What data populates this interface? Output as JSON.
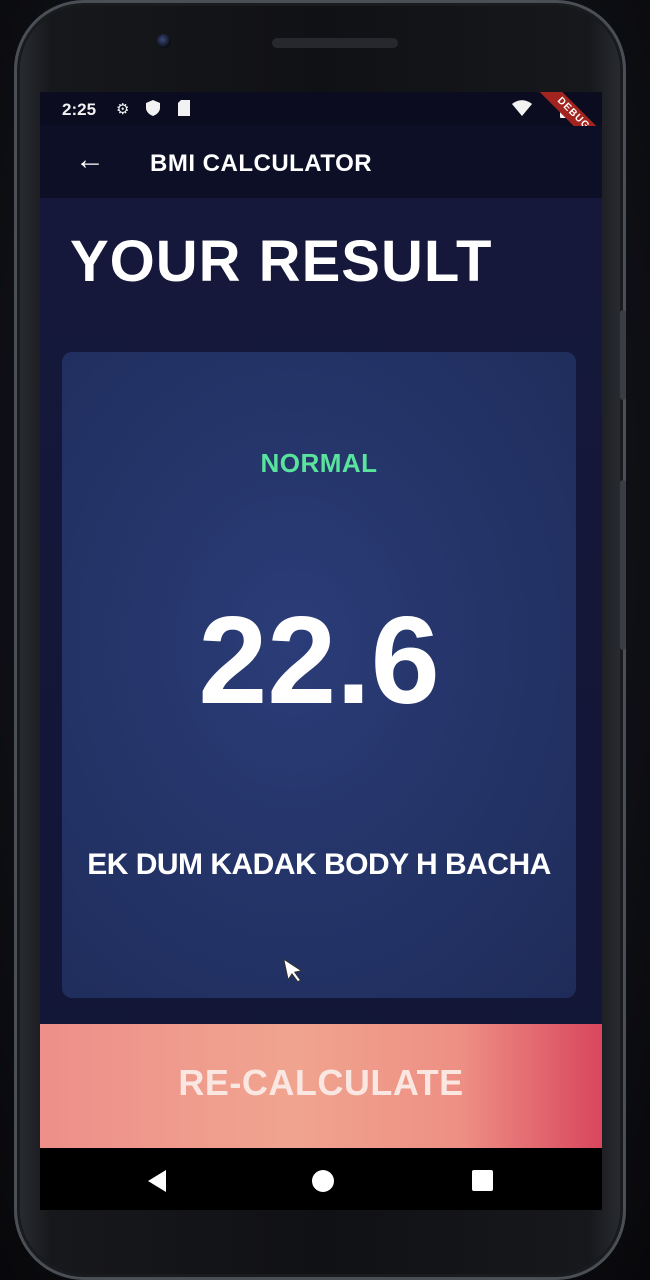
{
  "status_bar": {
    "time": "2:25",
    "left_icons": [
      "gear-icon",
      "shield-icon",
      "sim-card-icon"
    ],
    "right_icons": [
      "wifi-icon",
      "battery-icon"
    ],
    "debug_banner": "DEBUG"
  },
  "app_bar": {
    "back_icon": "←",
    "title": "BMI CALCULATOR"
  },
  "result": {
    "heading": "YOUR RESULT",
    "status": "NORMAL",
    "bmi": "22.6",
    "message": "EK DUM KADAK BODY H BACHA"
  },
  "button": {
    "label": "RE-CALCULATE"
  },
  "colors": {
    "background": "#121536",
    "card": "#243468",
    "status_text": "#59e39c",
    "button": "#ee8f8a"
  }
}
